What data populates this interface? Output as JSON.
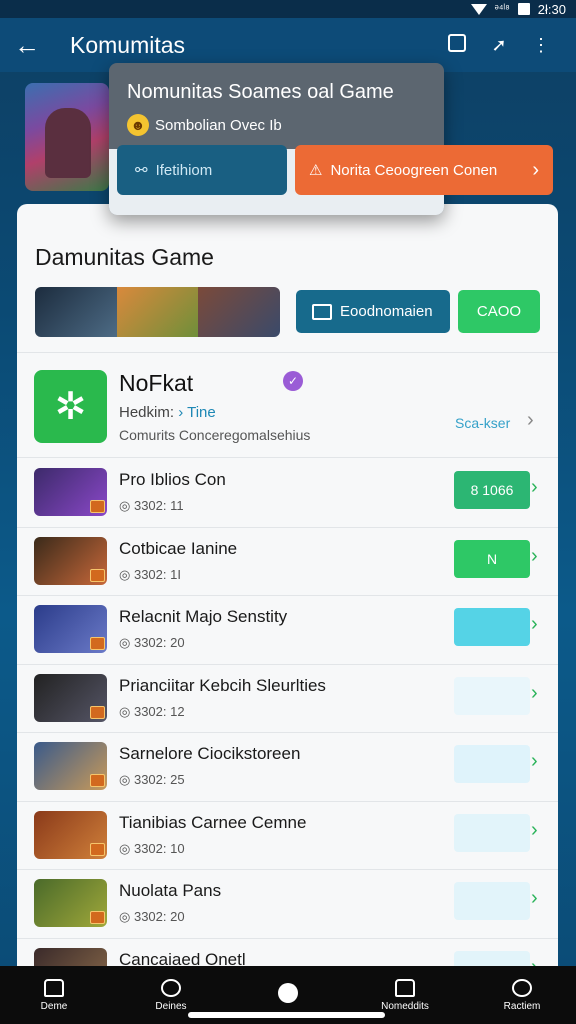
{
  "status_bar": {
    "signal": "ᵊ⁴ˡ⁸",
    "time": "2ł:30"
  },
  "app_bar": {
    "title": "Komumitas"
  },
  "popup": {
    "title": "Nomunitas Soames oal Game",
    "subtitle": "Sombolian Ovec Ib",
    "button_left": "Ifetihiom",
    "button_right": "Norita Ceoogreen Conen"
  },
  "card": {
    "title": "Damunitas Game",
    "button_primary": "Eoodnomaien",
    "button_green": "CAOO"
  },
  "featured": {
    "name": "NoFkat",
    "sub_prefix": "Hedkim:",
    "sub_link": "Tine",
    "desc": "Comurits Conceregomalsehius",
    "link": "Sca-kser"
  },
  "rows": [
    {
      "name": "Pro Iblios Con",
      "stat": "3302: 11",
      "btn": "8 1066",
      "color": "#2cb673",
      "t1": "#3c2a6a",
      "t2": "#8a48c8"
    },
    {
      "name": "Cotbicae Ianine",
      "stat": "3302: 1I",
      "btn": "N",
      "color": "#2ec866",
      "t1": "#3a2a1a",
      "t2": "#c8683a"
    },
    {
      "name": "Relacnit Majo Senstity",
      "stat": "3302: 20",
      "btn": "",
      "color": "#55d3e6",
      "t1": "#2b3c8a",
      "t2": "#6b7ac8"
    },
    {
      "name": "Prianciitar Kebcih Sleurlties",
      "stat": "3302: 12",
      "btn": "",
      "color": "#e9f6fb",
      "t1": "#222",
      "t2": "#556"
    },
    {
      "name": "Sarnelore Ciocikstoreen",
      "stat": "3302: 25",
      "btn": "",
      "color": "#dff3fb",
      "t1": "#3a5a8a",
      "t2": "#c89a5a"
    },
    {
      "name": "Tianibias Carnee Cemne",
      "stat": "3302: 10",
      "btn": "",
      "color": "#e2f4fa",
      "t1": "#8a3a1a",
      "t2": "#d0803a"
    },
    {
      "name": "Nuolata Pans",
      "stat": "3302: 20",
      "btn": "",
      "color": "#e2f4fa",
      "t1": "#4a6a2a",
      "t2": "#a0a83a"
    },
    {
      "name": "Cancaiaed Onetl",
      "stat": "",
      "btn": "",
      "color": "#e2f4fa",
      "t1": "#3a2a2a",
      "t2": "#8a6a4a"
    }
  ],
  "bottom_nav": [
    "Deme",
    "Deines",
    "",
    "Nomeddits",
    "Ractiem"
  ]
}
